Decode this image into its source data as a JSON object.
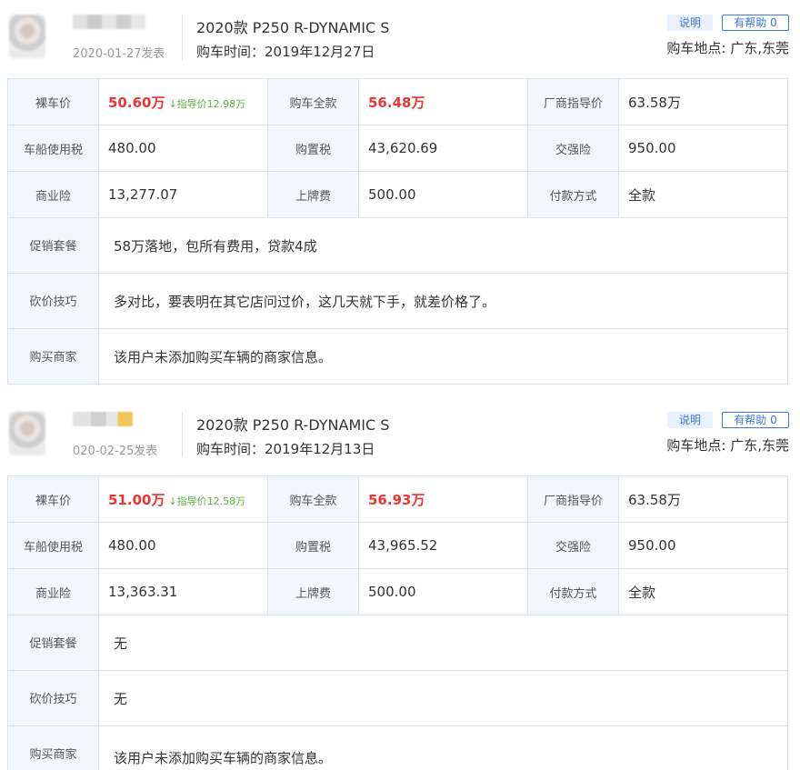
{
  "reviews": [
    {
      "post_date": "2020-01-27发表",
      "model": "2020款 P250 R-DYNAMIC S",
      "buy_time_label": "购车时间：",
      "buy_time": "2019年12月27日",
      "explain_btn": "说明",
      "helpful_btn": "有帮助 0",
      "location_label": "购车地点: ",
      "location": "广东,东莞",
      "bare_price_label": "裸车价",
      "bare_price": "50.60万",
      "guide_diff": "↓指导价12.98万",
      "total_label": "购车全款",
      "total": "56.48万",
      "msrp_label": "厂商指导价",
      "msrp": "63.58万",
      "vessel_tax_label": "车船使用税",
      "vessel_tax": "480.00",
      "purchase_tax_label": "购置税",
      "purchase_tax": "43,620.69",
      "compulsory_label": "交强险",
      "compulsory": "950.00",
      "commercial_label": "商业险",
      "commercial": "13,277.07",
      "plate_label": "上牌费",
      "plate": "500.00",
      "payment_label": "付款方式",
      "payment": "全款",
      "promo_label": "促销套餐",
      "promo": "58万落地，包所有费用，贷款4成",
      "bargain_label": "砍价技巧",
      "bargain": "多对比，要表明在其它店问过价，这几天就下手，就差价格了。",
      "dealer_label": "购买商家",
      "dealer": "该用户未添加购买车辆的商家信息。"
    },
    {
      "post_date": "020-02-25发表",
      "model": "2020款 P250 R-DYNAMIC S",
      "buy_time_label": "购车时间：",
      "buy_time": "2019年12月13日",
      "explain_btn": "说明",
      "helpful_btn": "有帮助 0",
      "location_label": "购车地点: ",
      "location": "广东,东莞",
      "bare_price_label": "裸车价",
      "bare_price": "51.00万",
      "guide_diff": "↓指导价12.58万",
      "total_label": "购车全款",
      "total": "56.93万",
      "msrp_label": "厂商指导价",
      "msrp": "63.58万",
      "vessel_tax_label": "车船使用税",
      "vessel_tax": "480.00",
      "purchase_tax_label": "购置税",
      "purchase_tax": "43,965.52",
      "compulsory_label": "交强险",
      "compulsory": "950.00",
      "commercial_label": "商业险",
      "commercial": "13,363.31",
      "plate_label": "上牌费",
      "plate": "500.00",
      "payment_label": "付款方式",
      "payment": "全款",
      "promo_label": "促销套餐",
      "promo": "无",
      "bargain_label": "砍价技巧",
      "bargain": "无",
      "dealer_label": "购买商家",
      "dealer": "该用户未添加购买车辆的商家信息。"
    }
  ]
}
